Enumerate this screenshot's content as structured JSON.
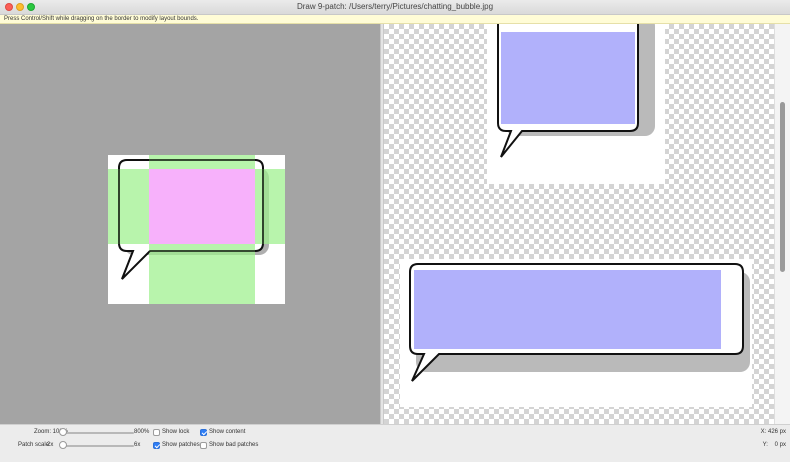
{
  "window": {
    "title": "Draw 9-patch: /Users/terry/Pictures/chatting_bubble.jpg",
    "controls": [
      "close",
      "minimize",
      "zoom"
    ]
  },
  "hint": "Press Control/Shift while dragging on the border to modify layout bounds.",
  "colors": {
    "editor_background": "#a4a4a4",
    "patch_green": "#b6f7a8",
    "content_pink": "#f7b1fb",
    "preview_content": "#b1b1fb",
    "checker": "#d4d4d4"
  },
  "controls": {
    "zoom": {
      "label": "Zoom: 100%",
      "max_label": "800%",
      "value_percent": 100
    },
    "patch_scale": {
      "label": "Patch scale:",
      "min_label": "2x",
      "max_label": "6x",
      "value": 2
    },
    "show_lock": {
      "label": "Show lock",
      "checked": false
    },
    "show_content": {
      "label": "Show content",
      "checked": true
    },
    "show_patches": {
      "label": "Show patches",
      "checked": true
    },
    "show_bad_patches": {
      "label": "Show bad patches",
      "checked": false
    }
  },
  "cursor": {
    "x": "X: 426 px",
    "y": "Y:    0 px"
  }
}
